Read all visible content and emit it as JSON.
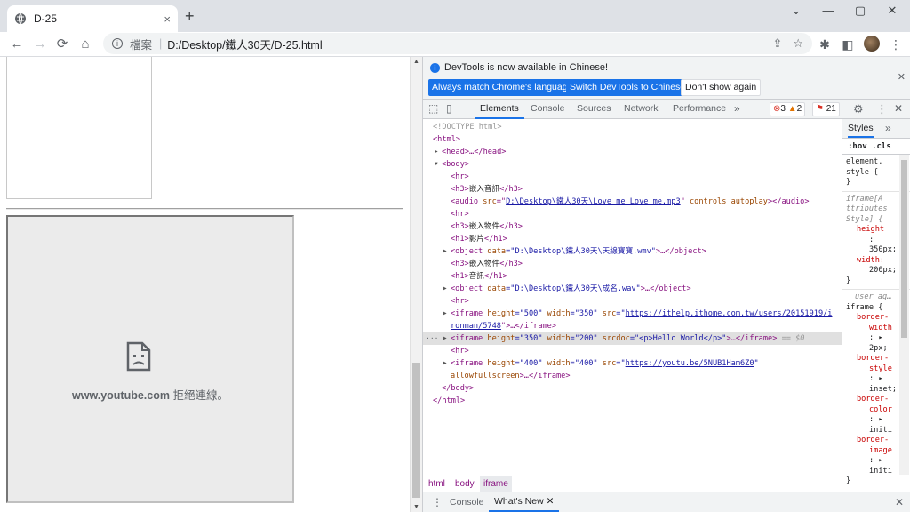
{
  "tab": {
    "title": "D-25",
    "close": "×",
    "new": "+"
  },
  "window": {
    "min": "⌄",
    "minimize": "—",
    "maximize": "▢",
    "close": "✕"
  },
  "toolbar": {
    "back": "←",
    "forward": "→",
    "reload": "⟳",
    "home": "⌂",
    "site_label": "檔案",
    "separator": "|",
    "url": "D:/Desktop/鐵人30天/D-25.html"
  },
  "youtube_error": {
    "domain": "www.youtube.com",
    "message": " 拒絕連線。"
  },
  "devtools": {
    "info": "DevTools is now available in Chinese!",
    "btn_match": "Always match Chrome's language",
    "btn_switch": "Switch DevTools to Chinese",
    "btn_dont": "Don't show again",
    "tabs": [
      "Elements",
      "Console",
      "Sources",
      "Network",
      "Performance"
    ],
    "more": "»",
    "errors": "3",
    "warnings": "2",
    "issues": "21",
    "crumbs": [
      "html",
      "body",
      "iframe"
    ],
    "drawer_tabs": [
      "Console",
      "What's New"
    ],
    "selected_suffix": "== $0"
  },
  "styles": {
    "tabs": [
      "Styles",
      "»"
    ],
    "filter": ":hov .cls",
    "element_style": [
      "element.",
      "style {",
      "}"
    ],
    "attr_rule": [
      "iframe[A",
      "ttributes",
      " Style] {",
      "height",
      ":",
      "350px;",
      "width:",
      "200px;",
      "}"
    ],
    "ua_rule": [
      "user ag…",
      "iframe {",
      "border-",
      "width",
      ": ▸",
      "2px;",
      "border-",
      "style",
      ": ▸",
      "inset;",
      "border-",
      "color",
      ": ▸",
      "initi",
      "border-",
      "image",
      ": ▸",
      "initi",
      "}"
    ]
  },
  "dom": {
    "doctype": "<!DOCTYPE html>",
    "html_open": "<html>",
    "head": "<head>…</head>",
    "body_open": "<body>",
    "hr": "<hr>",
    "h3_1": [
      "<h3>",
      "嵌入音訊",
      "</h3>"
    ],
    "audio": [
      "<audio ",
      "src",
      "=\"",
      "D:\\Desktop\\鐵人30天\\Love me Love me.mp3",
      "\" ",
      "controls autoplay",
      "></audio>"
    ],
    "h3_2": [
      "<h3>",
      "嵌入物件",
      "</h3>"
    ],
    "h1_1": [
      "<h1>",
      "影片",
      "</h1>"
    ],
    "object1": [
      "<object ",
      "data",
      "=\"D:\\Desktop\\鐵人30天\\天線寶寶.wmv\"",
      ">…</object>"
    ],
    "h3_3": [
      "<h3>",
      "嵌入物件",
      "</h3>"
    ],
    "h1_2": [
      "<h1>",
      "音訊",
      "</h1>"
    ],
    "object2": [
      "<object ",
      "data",
      "=\"D:\\Desktop\\鐵人30天\\成名.wav\"",
      ">…</object>"
    ],
    "iframe1": [
      "<iframe ",
      "height",
      "=\"500\" ",
      "width",
      "=\"350\" ",
      "src",
      "=\"",
      "https://ithelp.ithome.com.tw/users/20151919/i",
      "ronman/5748",
      "\">…</iframe>"
    ],
    "iframe2": [
      "<iframe ",
      "height",
      "=\"350\" ",
      "width",
      "=\"200\" ",
      "srcdoc",
      "=\"<p>Hello  World</p>\"",
      ">…</iframe>"
    ],
    "iframe3": [
      "<iframe ",
      "height",
      "=\"400\" ",
      "width",
      "=\"400\" ",
      "src",
      "=\"",
      "https://youtu.be/5NUB1Ham6Z0",
      "\"",
      "allowfullscreen",
      ">…</iframe>"
    ],
    "body_close": "</body>",
    "html_close": "</html>",
    "dots": "···"
  }
}
